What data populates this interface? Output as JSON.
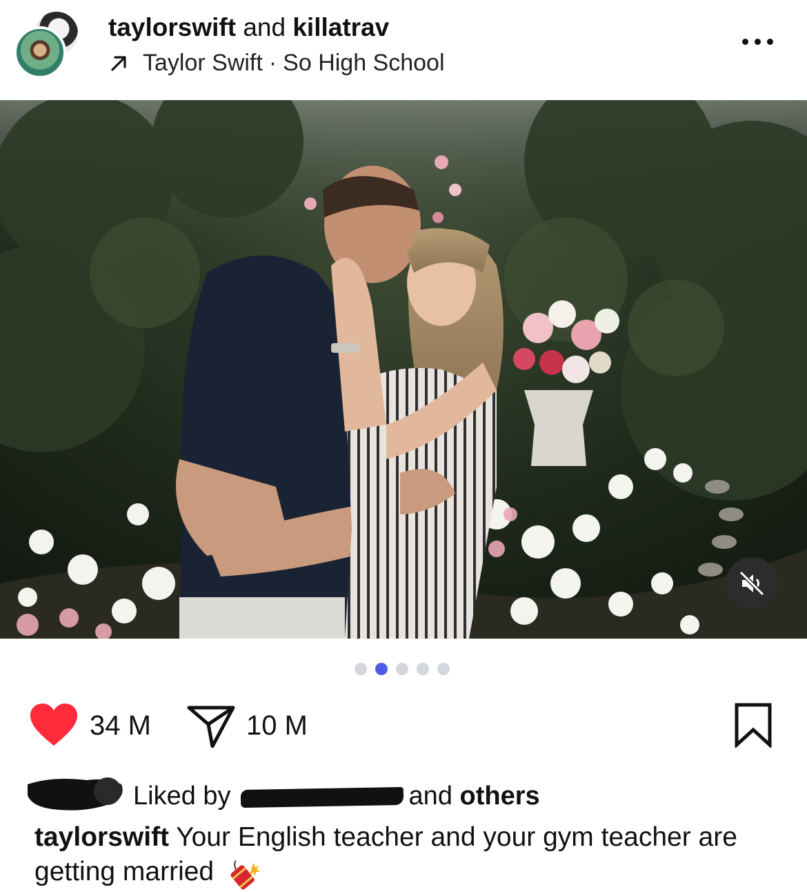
{
  "header": {
    "user1": "taylorswift",
    "conjunction": "and",
    "user2": "killatrav",
    "music_artist": "Taylor Swift",
    "music_separator": "·",
    "music_title": "So High School"
  },
  "icons": {
    "more": "more-horizontal-icon",
    "mute": "speaker-muted-icon",
    "like": "heart-filled-icon",
    "share": "send-paper-plane-icon",
    "save": "bookmark-icon"
  },
  "carousel": {
    "total_slides": 5,
    "active_index": 1
  },
  "actions": {
    "likes": "34 M",
    "shares": "10 M"
  },
  "liked_by": {
    "prefix": "Liked by",
    "middle": "and",
    "suffix": "others"
  },
  "caption": {
    "username": "taylorswift",
    "text": "Your English teacher and your gym teacher are getting married"
  },
  "colors": {
    "like": "#ff2a3a",
    "active_dot": "#4f5ce6",
    "inactive_dot": "#d3d6db"
  }
}
